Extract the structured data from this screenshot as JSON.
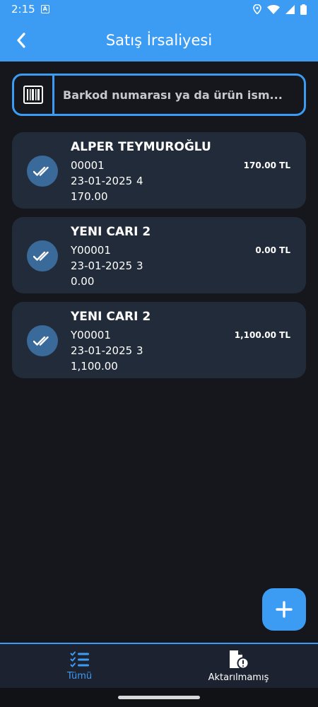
{
  "status_bar": {
    "time": "2:15",
    "notification_badge": "A"
  },
  "app_bar": {
    "title": "Satış İrsaliyesi",
    "back_icon": "back-arrow-icon"
  },
  "search": {
    "placeholder": "Barkod numarası ya da ürün ism...",
    "value": "",
    "barcode_icon": "barcode-icon"
  },
  "documents": [
    {
      "name": "ALPER TEYMUROĞLU",
      "code": "00001",
      "date": "23-01-2025",
      "count": "4",
      "total": "170.00",
      "amount": "170.00 TL",
      "status_icon": "double-check-icon"
    },
    {
      "name": "YENI CARI 2",
      "code": "Y00001",
      "date": "23-01-2025",
      "count": "3",
      "total": "0.00",
      "amount": "0.00 TL",
      "status_icon": "double-check-icon"
    },
    {
      "name": "YENI CARI 2",
      "code": "Y00001",
      "date": "23-01-2025",
      "count": "3",
      "total": "1,100.00",
      "amount": "1,100.00 TL",
      "status_icon": "double-check-icon"
    }
  ],
  "fab": {
    "icon": "plus-icon"
  },
  "bottom_nav": {
    "items": [
      {
        "label": "Tümü",
        "icon": "list-check-icon",
        "active": true
      },
      {
        "label": "Aktarılmamış",
        "icon": "document-alert-icon",
        "active": false
      }
    ]
  },
  "colors": {
    "accent": "#3c9cf3",
    "background": "#16171d",
    "card": "#222b39",
    "check_circle": "#3a6a99",
    "nav_background": "#1c2230"
  }
}
